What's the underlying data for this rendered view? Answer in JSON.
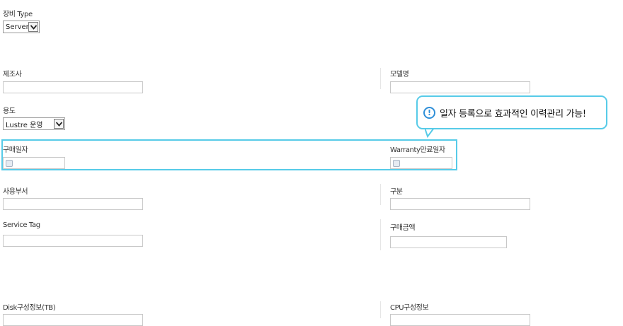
{
  "equipment_type": {
    "label": "장비 Type",
    "value": "Server"
  },
  "left": {
    "manufacturer": {
      "label": "제조사"
    },
    "purpose": {
      "label": "용도",
      "value": "Lustre 운영"
    },
    "purchase_date": {
      "label": "구매일자"
    },
    "department": {
      "label": "사용부서"
    },
    "service_tag": {
      "label": "Service Tag"
    },
    "disk_info": {
      "label": "Disk구성정보(TB)"
    }
  },
  "right": {
    "model_name": {
      "label": "모델명"
    },
    "warranty_end": {
      "label": "Warranty만료일자"
    },
    "category": {
      "label": "구분"
    },
    "purchase_amount": {
      "label": "구매금액"
    },
    "cpu_info": {
      "label": "CPU구성정보"
    }
  },
  "callout": {
    "text": "일자 등록으로 효과적인 이력관리 가능!",
    "icon_glyph": "!",
    "icon": "info-icon"
  },
  "colors": {
    "highlight": "#57cbe8",
    "info_icon": "#2f8fd8"
  }
}
